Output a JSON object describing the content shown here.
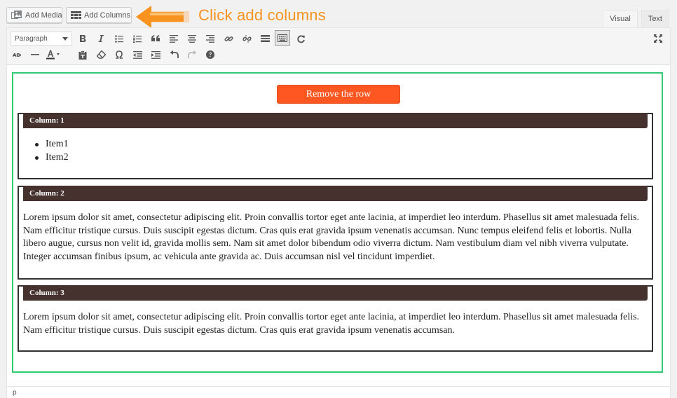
{
  "media_buttons": {
    "add_media_label": "Add Media",
    "add_columns_label": "Add Columns"
  },
  "annotation": {
    "text": "Click add columns",
    "color": "#f7931e"
  },
  "editor_tabs": [
    {
      "label": "Visual",
      "active": true
    },
    {
      "label": "Text",
      "active": false
    }
  ],
  "toolbar": {
    "format_select_value": "Paragraph",
    "row1_icons": [
      "bold-icon",
      "italic-icon",
      "bulleted-list-icon",
      "numbered-list-icon",
      "blockquote-icon",
      "align-left-icon",
      "align-center-icon",
      "align-right-icon",
      "insert-link-icon",
      "remove-link-icon",
      "read-more-icon",
      "toolbar-toggle-icon",
      "refresh-icon",
      "fullscreen-icon"
    ],
    "row2_icons": [
      "strikethrough-icon",
      "horizontal-line-icon",
      "text-color-icon",
      "paste-as-text-icon",
      "clear-formatting-icon",
      "special-character-icon",
      "outdent-icon",
      "indent-icon",
      "undo-icon",
      "redo-icon",
      "help-icon"
    ]
  },
  "row": {
    "remove_button_label": "Remove the row",
    "border_color": "#2ecc71",
    "button_color": "#ff5722"
  },
  "columns": [
    {
      "header": "Column: 1",
      "list_items": [
        "Item1",
        "Item2"
      ]
    },
    {
      "header": "Column: 2",
      "paragraph": "Lorem ipsum dolor sit amet, consectetur adipiscing elit. Proin convallis tortor eget ante lacinia, at imperdiet leo interdum. Phasellus sit amet malesuada felis. Nam efficitur tristique cursus. Duis suscipit egestas dictum. Cras quis erat gravida ipsum venenatis accumsan. Nunc tempus eleifend felis et lobortis. Nulla libero augue, cursus non velit id, gravida mollis sem. Nam sit amet dolor bibendum odio viverra dictum. Nam vestibulum diam vel nibh viverra vulputate. Integer accumsan finibus ipsum, ac vehicula ante gravida ac. Duis accumsan nisl vel tincidunt imperdiet."
    },
    {
      "header": "Column: 3",
      "paragraph": "Lorem ipsum dolor sit amet, consectetur adipiscing elit. Proin convallis tortor eget ante lacinia, at imperdiet leo interdum. Phasellus sit amet malesuada felis. Nam efficitur tristique cursus. Duis suscipit egestas dictum. Cras quis erat gravida ipsum venenatis accumsan."
    }
  ],
  "colors": {
    "column_header_bg": "#45322e",
    "column_border": "#333333"
  },
  "statusbar": {
    "path": "p"
  }
}
